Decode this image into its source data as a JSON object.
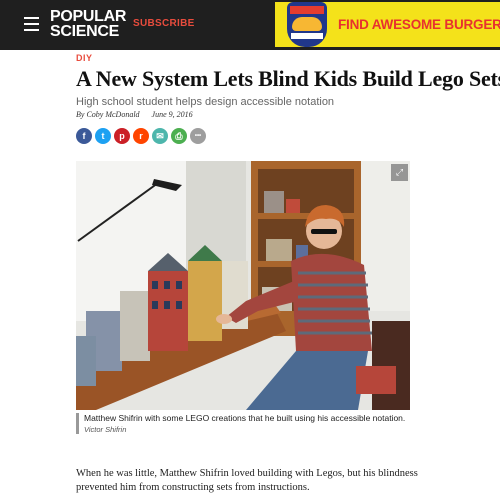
{
  "header": {
    "logo_line1": "POPULAR",
    "logo_line2": "SCIENCE",
    "subscribe_label": "SUBSCRIBE"
  },
  "ad": {
    "badge_text": "BURGER",
    "headline": "FIND AWESOME BURGERS NEA"
  },
  "article": {
    "category": "DIY",
    "title": "A New System Lets Blind Kids Build Lego Sets",
    "subtitle": "High school student helps design accessible notation",
    "author": "By Coby McDonald",
    "date": "June 9, 2016",
    "share_icons": [
      {
        "name": "facebook-icon",
        "glyph": "f",
        "color": "#3b5998"
      },
      {
        "name": "twitter-icon",
        "glyph": "t",
        "color": "#1da1f2"
      },
      {
        "name": "pinterest-icon",
        "glyph": "p",
        "color": "#cb2027"
      },
      {
        "name": "reddit-icon",
        "glyph": "r",
        "color": "#ff4500"
      },
      {
        "name": "email-icon",
        "glyph": "✉",
        "color": "#4db6ac"
      },
      {
        "name": "print-icon",
        "glyph": "⎙",
        "color": "#4caf50"
      },
      {
        "name": "more-icon",
        "glyph": "•••",
        "color": "#9e9e9e"
      }
    ],
    "photo": {
      "caption": "Matthew Shifrin with some LEGO creations that he built using his accessible notation.",
      "credit": "Victor Shifrin"
    },
    "body": "When he was little, Matthew Shifrin loved building with Legos, but his blindness prevented him from constructing sets from instructions."
  },
  "colors": {
    "accent": "#e84c3d",
    "header_bg": "#1f1f1f",
    "ad_bg": "#f4e21a"
  }
}
